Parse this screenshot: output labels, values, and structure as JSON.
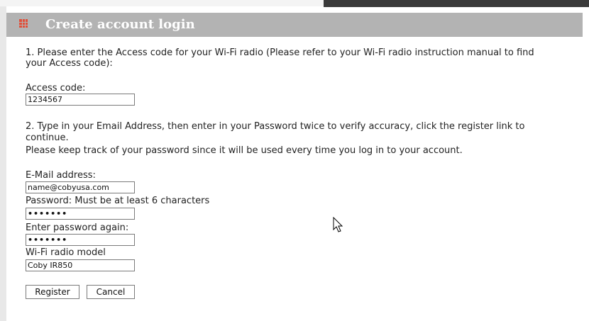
{
  "header": {
    "title": "Create account login"
  },
  "instructions": {
    "step1_line1": "1. Please enter the Access code for your Wi-Fi radio (Please refer to your Wi-Fi radio instruction manual to find",
    "step1_line2": "your Access code):",
    "step2_line1": "2. Type in your Email Address, then enter in your Password twice to verify accuracy, click the register link to",
    "step2_line2": "continue.",
    "step2_line3": "Please keep track of your password since it will be used every time you log in to your account."
  },
  "form": {
    "access_code_label": "Access code:",
    "access_code_value": "1234567",
    "email_label": "E-Mail address:",
    "email_value": "name@cobyusa.com",
    "password_label": "Password: Must be at least 6 characters",
    "password_value": "•••••••",
    "password_again_label": "Enter password again:",
    "password_again_value": "•••••••",
    "model_label": "Wi-Fi radio model",
    "model_value": "Coby IR850"
  },
  "buttons": {
    "register": "Register",
    "cancel": "Cancel"
  },
  "colors": {
    "header_bg": "#b3b3b3",
    "header_text": "#ffffff",
    "icon": "#e0503a"
  }
}
